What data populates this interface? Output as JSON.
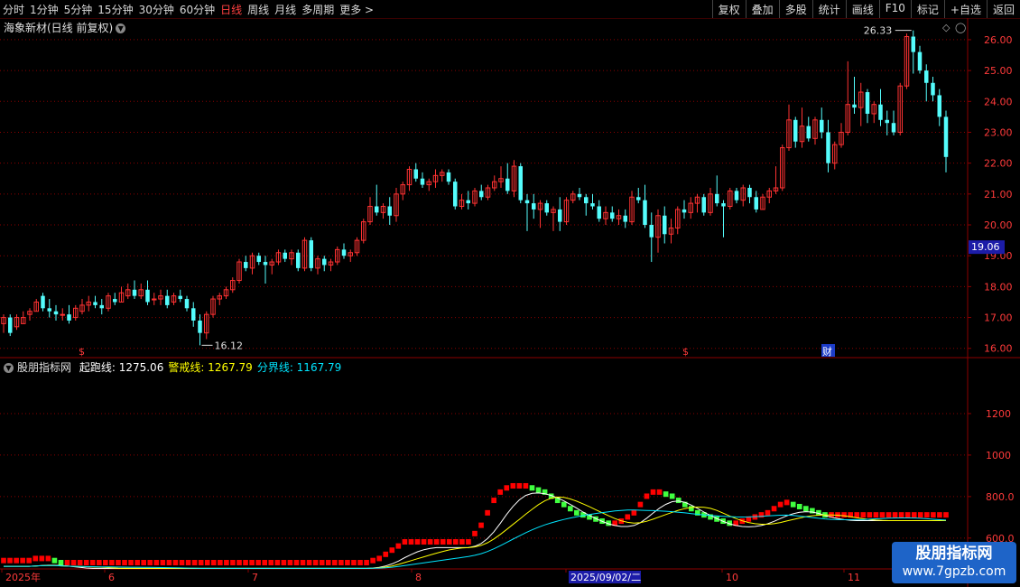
{
  "toolbar": {
    "periods": [
      "分时",
      "1分钟",
      "5分钟",
      "15分钟",
      "30分钟",
      "60分钟",
      "日线",
      "周线",
      "月线",
      "多周期",
      "更多 >"
    ],
    "active": "日线",
    "right": [
      "复权",
      "叠加",
      "多股",
      "统计",
      "画线",
      "F10",
      "标记",
      "+自选",
      "返回"
    ]
  },
  "stock": {
    "title": "海象新材(日线 前复权)"
  },
  "price_axis": [
    "26.00",
    "25.00",
    "24.00",
    "23.00",
    "22.00",
    "21.00",
    "20.00",
    "19.00",
    "18.00",
    "17.00",
    "16.00"
  ],
  "current_price_tag": "19.06",
  "annotations": {
    "high": "26.33",
    "low": "16.12",
    "dollar": "$",
    "cai": "财"
  },
  "indicator": {
    "name": "股朋指标网",
    "items": [
      {
        "label": "起跑线:",
        "value": "1275.06",
        "color": "#ffffff"
      },
      {
        "label": "警戒线:",
        "value": "1267.79",
        "color": "#ffff00"
      },
      {
        "label": "分界线:",
        "value": "1167.79",
        "color": "#00e5ff"
      }
    ],
    "axis": [
      "1200",
      "1000",
      "800.0",
      "600.0"
    ]
  },
  "date_axis": [
    "2025年",
    "6",
    "7",
    "8",
    "9",
    "10",
    "11"
  ],
  "date_highlight": "2025/09/02/二",
  "watermark": {
    "line1": "股朋指标网",
    "line2": "www.7gpzb.com"
  },
  "colors": {
    "up": "#ff3232",
    "down": "#54fcfc",
    "ind_up": "#ff0000",
    "ind_down": "#40ff40",
    "grid": "#8b0000"
  },
  "chart_data": {
    "type": "candlestick",
    "title": "海象新材(日线 前复权)",
    "price_ylim": [
      15.7,
      26.7
    ],
    "ohlc": [
      [
        16.8,
        17.1,
        16.5,
        17.0
      ],
      [
        17.0,
        17.1,
        16.4,
        16.5
      ],
      [
        16.7,
        17.1,
        16.6,
        17.0
      ],
      [
        16.8,
        17.2,
        16.8,
        17.0
      ],
      [
        17.1,
        17.3,
        16.9,
        17.2
      ],
      [
        17.2,
        17.6,
        17.2,
        17.5
      ],
      [
        17.7,
        17.8,
        17.2,
        17.3
      ],
      [
        17.3,
        17.6,
        17.0,
        17.2
      ],
      [
        17.2,
        17.4,
        16.9,
        17.1
      ],
      [
        17.1,
        17.3,
        16.9,
        17.1
      ],
      [
        17.1,
        17.4,
        16.8,
        16.9
      ],
      [
        17.0,
        17.4,
        16.9,
        17.3
      ],
      [
        17.2,
        17.6,
        17.1,
        17.4
      ],
      [
        17.4,
        17.7,
        17.2,
        17.5
      ],
      [
        17.5,
        17.7,
        17.3,
        17.4
      ],
      [
        17.4,
        17.6,
        17.1,
        17.3
      ],
      [
        17.3,
        17.8,
        17.2,
        17.7
      ],
      [
        17.6,
        17.8,
        17.4,
        17.5
      ],
      [
        17.5,
        18.0,
        17.5,
        17.8
      ],
      [
        17.7,
        18.1,
        17.6,
        17.9
      ],
      [
        17.9,
        18.2,
        17.6,
        17.7
      ],
      [
        17.7,
        18.1,
        17.6,
        17.9
      ],
      [
        17.9,
        18.2,
        17.4,
        17.5
      ],
      [
        17.6,
        17.8,
        17.4,
        17.6
      ],
      [
        17.6,
        17.9,
        17.4,
        17.7
      ],
      [
        17.7,
        17.9,
        17.3,
        17.4
      ],
      [
        17.5,
        17.8,
        17.4,
        17.7
      ],
      [
        17.7,
        17.9,
        17.5,
        17.6
      ],
      [
        17.6,
        17.7,
        17.2,
        17.3
      ],
      [
        17.3,
        17.5,
        16.7,
        16.9
      ],
      [
        16.9,
        17.1,
        16.1,
        16.5
      ],
      [
        16.5,
        17.2,
        16.3,
        17.1
      ],
      [
        17.1,
        17.7,
        17.0,
        17.6
      ],
      [
        17.6,
        17.8,
        17.4,
        17.7
      ],
      [
        17.7,
        18.0,
        17.6,
        17.9
      ],
      [
        17.9,
        18.3,
        17.8,
        18.2
      ],
      [
        18.2,
        18.9,
        18.1,
        18.8
      ],
      [
        18.8,
        19.0,
        18.5,
        18.6
      ],
      [
        18.6,
        19.1,
        18.4,
        19.0
      ],
      [
        19.0,
        19.1,
        18.7,
        18.8
      ],
      [
        18.8,
        19.0,
        18.1,
        18.7
      ],
      [
        18.7,
        18.9,
        18.4,
        18.8
      ],
      [
        18.8,
        19.2,
        18.7,
        19.1
      ],
      [
        19.1,
        19.2,
        18.8,
        18.9
      ],
      [
        18.9,
        19.2,
        18.7,
        19.1
      ],
      [
        19.1,
        19.2,
        18.5,
        18.6
      ],
      [
        18.6,
        19.6,
        18.5,
        19.5
      ],
      [
        19.5,
        19.6,
        18.5,
        18.6
      ],
      [
        18.6,
        19.0,
        18.4,
        18.9
      ],
      [
        18.9,
        19.0,
        18.5,
        18.7
      ],
      [
        18.7,
        18.9,
        18.5,
        18.8
      ],
      [
        18.8,
        19.3,
        18.7,
        19.2
      ],
      [
        19.2,
        19.4,
        18.9,
        19.0
      ],
      [
        19.0,
        19.2,
        18.8,
        19.1
      ],
      [
        19.1,
        19.6,
        19.0,
        19.5
      ],
      [
        19.5,
        20.2,
        19.4,
        20.1
      ],
      [
        20.1,
        20.9,
        20.0,
        20.6
      ],
      [
        20.6,
        21.3,
        20.3,
        20.4
      ],
      [
        20.4,
        20.7,
        20.2,
        20.6
      ],
      [
        20.6,
        20.9,
        20.0,
        20.3
      ],
      [
        20.3,
        21.2,
        20.1,
        21.0
      ],
      [
        21.0,
        21.4,
        20.8,
        21.3
      ],
      [
        21.3,
        21.9,
        21.1,
        21.8
      ],
      [
        21.8,
        22.0,
        21.4,
        21.5
      ],
      [
        21.5,
        21.7,
        21.2,
        21.3
      ],
      [
        21.3,
        21.5,
        21.1,
        21.4
      ],
      [
        21.4,
        21.8,
        21.2,
        21.6
      ],
      [
        21.6,
        21.8,
        21.4,
        21.7
      ],
      [
        21.7,
        21.8,
        21.3,
        21.4
      ],
      [
        21.4,
        21.5,
        20.5,
        20.6
      ],
      [
        20.6,
        21.0,
        20.5,
        20.8
      ],
      [
        20.8,
        21.1,
        20.5,
        20.7
      ],
      [
        20.7,
        21.2,
        20.6,
        21.1
      ],
      [
        21.1,
        21.3,
        20.8,
        20.9
      ],
      [
        20.9,
        21.3,
        20.8,
        21.2
      ],
      [
        21.2,
        21.6,
        21.1,
        21.4
      ],
      [
        21.4,
        21.9,
        21.2,
        21.5
      ],
      [
        21.5,
        22.0,
        21.0,
        21.1
      ],
      [
        21.1,
        22.1,
        20.9,
        21.9
      ],
      [
        21.9,
        22.0,
        20.7,
        20.8
      ],
      [
        20.8,
        21.0,
        19.8,
        20.7
      ],
      [
        20.7,
        21.0,
        20.2,
        20.5
      ],
      [
        20.5,
        20.8,
        19.9,
        20.7
      ],
      [
        20.7,
        20.8,
        20.3,
        20.4
      ],
      [
        20.4,
        20.6,
        19.8,
        20.5
      ],
      [
        20.5,
        20.9,
        19.8,
        20.1
      ],
      [
        20.1,
        20.9,
        20.0,
        20.8
      ],
      [
        20.8,
        21.1,
        20.7,
        21.0
      ],
      [
        21.0,
        21.2,
        20.8,
        20.9
      ],
      [
        20.9,
        21.0,
        20.3,
        20.7
      ],
      [
        20.7,
        21.0,
        20.5,
        20.6
      ],
      [
        20.6,
        20.8,
        20.1,
        20.2
      ],
      [
        20.2,
        20.6,
        20.0,
        20.4
      ],
      [
        20.4,
        20.6,
        20.1,
        20.2
      ],
      [
        20.2,
        20.5,
        20.0,
        20.3
      ],
      [
        20.3,
        20.5,
        19.9,
        20.1
      ],
      [
        20.1,
        21.1,
        20.0,
        20.9
      ],
      [
        20.9,
        21.2,
        20.7,
        20.8
      ],
      [
        20.8,
        21.3,
        19.9,
        20.0
      ],
      [
        20.0,
        20.4,
        18.8,
        19.6
      ],
      [
        19.6,
        20.5,
        19.1,
        20.3
      ],
      [
        20.3,
        20.6,
        19.4,
        19.7
      ],
      [
        19.7,
        20.2,
        19.4,
        19.9
      ],
      [
        19.9,
        20.6,
        19.7,
        20.5
      ],
      [
        20.5,
        20.8,
        20.2,
        20.4
      ],
      [
        20.4,
        20.9,
        20.2,
        20.7
      ],
      [
        20.7,
        21.0,
        20.4,
        20.9
      ],
      [
        20.9,
        21.0,
        20.3,
        20.4
      ],
      [
        20.4,
        21.2,
        20.3,
        21.0
      ],
      [
        21.0,
        21.6,
        20.6,
        20.7
      ],
      [
        20.7,
        20.8,
        19.6,
        20.6
      ],
      [
        20.6,
        21.2,
        20.5,
        21.1
      ],
      [
        21.1,
        21.2,
        20.7,
        20.8
      ],
      [
        20.8,
        21.3,
        20.6,
        21.2
      ],
      [
        21.2,
        21.3,
        20.7,
        20.9
      ],
      [
        20.9,
        21.1,
        20.4,
        20.5
      ],
      [
        20.5,
        21.0,
        20.5,
        20.9
      ],
      [
        20.9,
        21.2,
        20.7,
        21.1
      ],
      [
        21.1,
        21.9,
        21.0,
        21.2
      ],
      [
        21.2,
        22.6,
        21.1,
        22.5
      ],
      [
        22.5,
        23.9,
        22.4,
        23.4
      ],
      [
        23.4,
        23.5,
        22.5,
        22.7
      ],
      [
        22.7,
        23.8,
        22.5,
        23.2
      ],
      [
        23.2,
        23.5,
        22.7,
        22.8
      ],
      [
        22.8,
        23.5,
        22.6,
        23.4
      ],
      [
        23.4,
        23.8,
        22.8,
        23.0
      ],
      [
        23.0,
        23.4,
        21.7,
        22.0
      ],
      [
        22.0,
        22.7,
        21.8,
        22.6
      ],
      [
        22.6,
        23.3,
        22.5,
        23.0
      ],
      [
        23.0,
        25.3,
        22.9,
        23.9
      ],
      [
        23.9,
        24.8,
        23.6,
        23.8
      ],
      [
        23.8,
        24.6,
        23.2,
        24.3
      ],
      [
        24.3,
        24.4,
        23.3,
        23.6
      ],
      [
        23.6,
        24.0,
        23.3,
        23.9
      ],
      [
        23.9,
        24.4,
        23.2,
        23.4
      ],
      [
        23.4,
        23.7,
        22.9,
        23.3
      ],
      [
        23.3,
        23.7,
        22.9,
        23.0
      ],
      [
        23.0,
        24.6,
        22.9,
        24.5
      ],
      [
        24.5,
        26.2,
        24.4,
        26.1
      ],
      [
        26.1,
        26.3,
        24.9,
        25.6
      ],
      [
        25.6,
        25.8,
        24.9,
        25.0
      ],
      [
        25.0,
        25.2,
        24.0,
        24.6
      ],
      [
        24.6,
        24.8,
        24.0,
        24.2
      ],
      [
        24.2,
        24.4,
        23.2,
        23.5
      ],
      [
        23.5,
        23.7,
        21.7,
        22.2
      ]
    ],
    "indicator_ylim": [
      460,
      1400
    ],
    "indicator_values": [
      470,
      470,
      470,
      470,
      470,
      480,
      480,
      480,
      470,
      460,
      460,
      460,
      460,
      460,
      460,
      460,
      460,
      460,
      460,
      460,
      460,
      460,
      460,
      460,
      460,
      460,
      460,
      460,
      460,
      460,
      460,
      460,
      460,
      460,
      460,
      460,
      460,
      460,
      460,
      460,
      460,
      460,
      460,
      460,
      460,
      460,
      460,
      460,
      460,
      460,
      460,
      460,
      460,
      460,
      460,
      460,
      460,
      460,
      470,
      480,
      500,
      520,
      540,
      560,
      560,
      560,
      560,
      560,
      560,
      560,
      560,
      560,
      560,
      560,
      600,
      640,
      700,
      760,
      800,
      820,
      830,
      830,
      830,
      820,
      810,
      800,
      780,
      760,
      740,
      720,
      700,
      690,
      680,
      670,
      660,
      650,
      650,
      660,
      680,
      700,
      740,
      780,
      800,
      800,
      790,
      780,
      760,
      740,
      720,
      700,
      690,
      680,
      670,
      660,
      650,
      650,
      660,
      670,
      680,
      690,
      700,
      720,
      740,
      750,
      740,
      730,
      720,
      710,
      700,
      690,
      690,
      690,
      690,
      690,
      690,
      690,
      690,
      690,
      690,
      690,
      690,
      690,
      690,
      690,
      690,
      690,
      690,
      690,
      690
    ],
    "series": [
      {
        "name": "起跑线",
        "value": 1275.06
      },
      {
        "name": "警戒线",
        "value": 1267.79
      },
      {
        "name": "分界线",
        "value": 1167.79
      }
    ]
  }
}
